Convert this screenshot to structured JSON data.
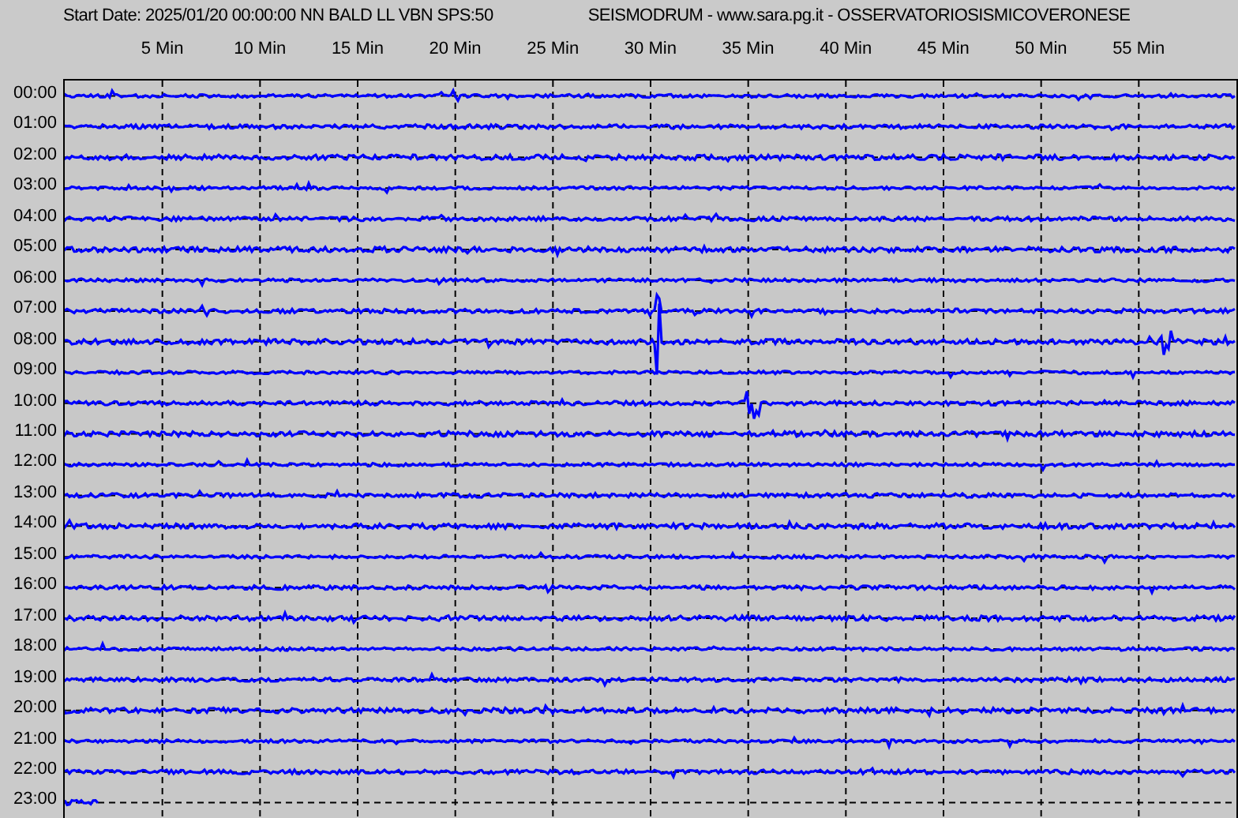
{
  "header": {
    "start_info": "Start Date: 2025/01/20 00:00:00 NN BALD LL VBN SPS:50",
    "station": "SEISMODRUM - www.sara.pg.it - OSSERVATORIOSISMICOVERONESE"
  },
  "minute_labels": [
    "5 Min",
    "10 Min",
    "15 Min",
    "20 Min",
    "25 Min",
    "30 Min",
    "35 Min",
    "40 Min",
    "45 Min",
    "50 Min",
    "55 Min"
  ],
  "rows": [
    {
      "hour": "00:00",
      "level": 1
    },
    {
      "hour": "01:00",
      "level": 1
    },
    {
      "hour": "02:00",
      "level": 1
    },
    {
      "hour": "03:00",
      "level": 1
    },
    {
      "hour": "04:00",
      "level": 1
    },
    {
      "hour": "05:00",
      "level": 1
    },
    {
      "hour": "06:00",
      "level": 1
    },
    {
      "hour": "07:00",
      "level": 1
    },
    {
      "hour": "08:00",
      "level": 1
    },
    {
      "hour": "09:00",
      "level": 1
    },
    {
      "hour": "10:00",
      "level": 1
    },
    {
      "hour": "11:00",
      "level": 1
    },
    {
      "hour": "12:00",
      "level": 1
    },
    {
      "hour": "13:00",
      "level": 1
    },
    {
      "hour": "14:00",
      "level": 1
    },
    {
      "hour": "15:00",
      "level": 1
    },
    {
      "hour": "16:00",
      "level": 1
    },
    {
      "hour": "17:00",
      "level": 1
    },
    {
      "hour": "18:00",
      "level": 1
    },
    {
      "hour": "19:00",
      "level": 1
    },
    {
      "hour": "20:00",
      "level": 1
    },
    {
      "hour": "21:00",
      "level": 1
    },
    {
      "hour": "22:00",
      "level": 1
    },
    {
      "hour": "23:00",
      "level": 0.03
    }
  ]
}
